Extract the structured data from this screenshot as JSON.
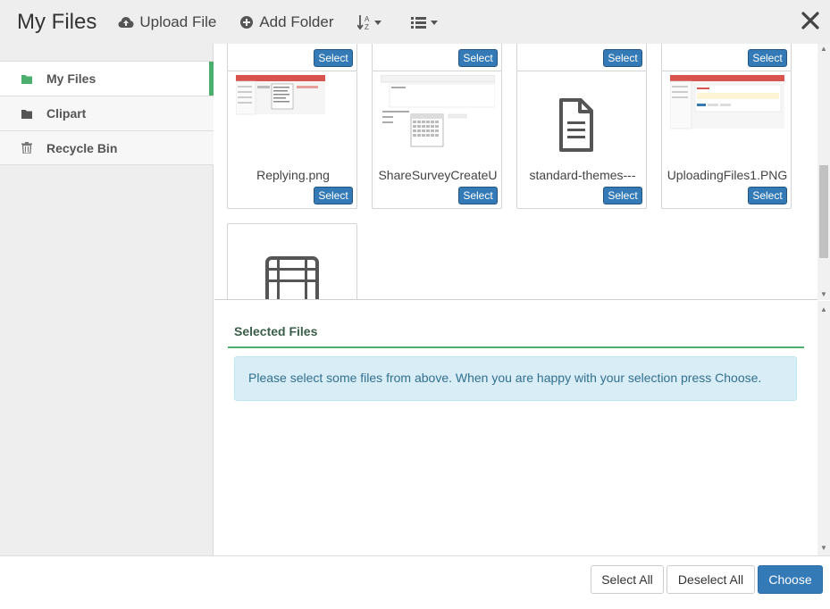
{
  "header": {
    "title": "My Files",
    "upload_label": "Upload File",
    "add_folder_label": "Add Folder"
  },
  "sidebar": {
    "items": [
      {
        "label": "My Files",
        "icon": "folder-icon",
        "active": true
      },
      {
        "label": "Clipart",
        "icon": "folder-icon",
        "active": false
      },
      {
        "label": "Recycle Bin",
        "icon": "trash-icon",
        "active": false
      }
    ]
  },
  "files": {
    "select_label": "Select",
    "row_top": [
      "",
      "",
      "",
      ""
    ],
    "row_middle": [
      {
        "name": "Replying.png"
      },
      {
        "name": "ShareSurveyCreateU"
      },
      {
        "name": "standard-themes---"
      },
      {
        "name": "UploadingFiles1.PNG"
      }
    ]
  },
  "selected": {
    "title": "Selected Files",
    "message": "Please select some files from above. When you are happy with your selection press Choose."
  },
  "footer": {
    "select_all": "Select All",
    "deselect_all": "Deselect All",
    "choose": "Choose"
  },
  "colors": {
    "accent_green": "#4caf6e",
    "primary_blue": "#337ab7",
    "info_bg": "#d9edf7"
  }
}
